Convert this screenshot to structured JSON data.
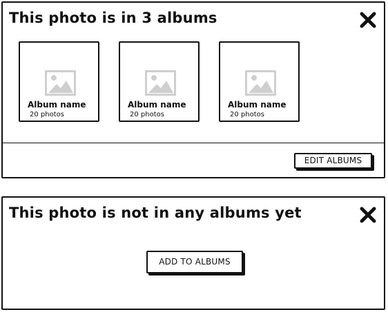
{
  "with_albums": {
    "title": "This photo is in 3 albums",
    "close_icon": "close-x-icon",
    "albums": [
      {
        "name": "Album name",
        "count": "20 photos",
        "icon": "image-placeholder-icon"
      },
      {
        "name": "Album name",
        "count": "20 photos",
        "icon": "image-placeholder-icon"
      },
      {
        "name": "Album name",
        "count": "20 photos",
        "icon": "image-placeholder-icon"
      }
    ],
    "edit_label": "EDIT ALBUMS"
  },
  "no_albums": {
    "title": "This photo is not in any albums yet",
    "close_icon": "close-x-icon",
    "add_label": "ADD TO ALBUMS"
  }
}
